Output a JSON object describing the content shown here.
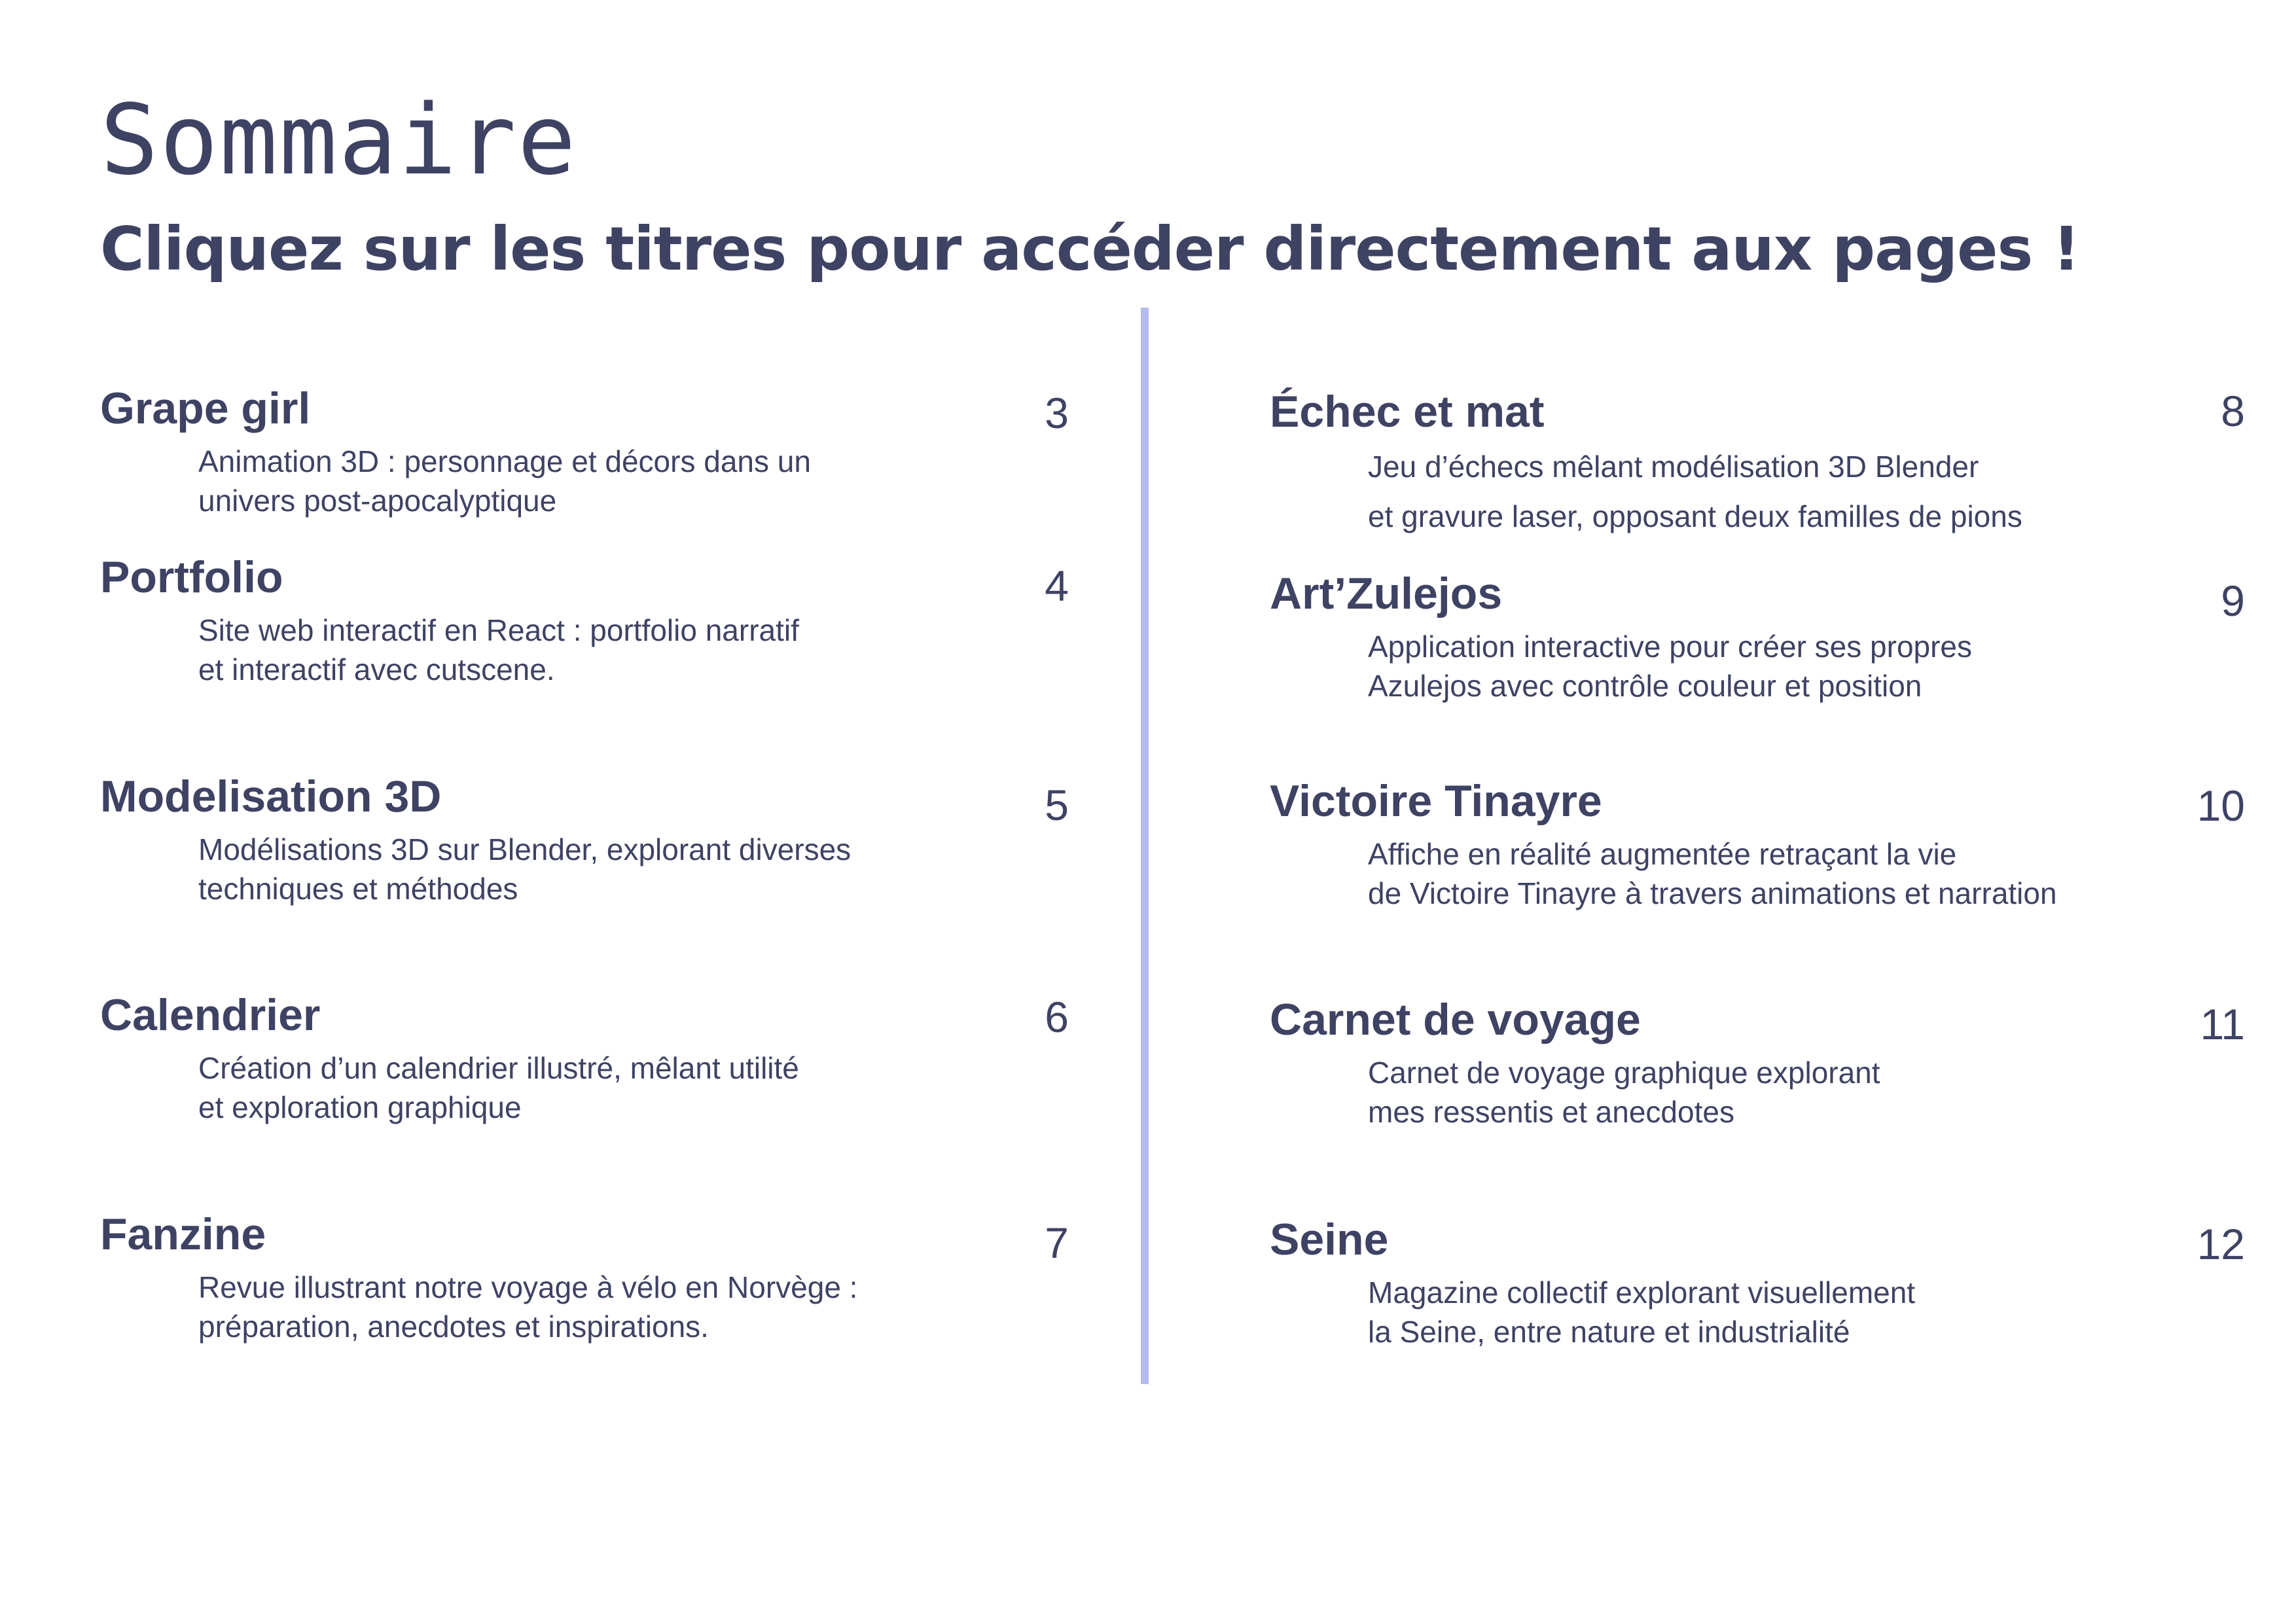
{
  "page": {
    "title": "Sommaire",
    "subtitle": "Cliquez sur les titres pour accéder directement aux pages !"
  },
  "colors": {
    "text": "#3e4263",
    "divider": "#b5baf2",
    "background": "#ffffff"
  },
  "left_entries": [
    {
      "title": "Grape girl",
      "page": "3",
      "desc_line1": "Animation 3D : personnage et décors dans un",
      "desc_line2": "univers post-apocalyptique"
    },
    {
      "title": "Portfolio",
      "page": "4",
      "desc_line1": "Site web interactif en React : portfolio narratif",
      "desc_line2": "et interactif avec cutscene."
    },
    {
      "title": "Modelisation 3D",
      "page": "5",
      "desc_line1": "Modélisations 3D sur Blender, explorant diverses",
      "desc_line2": "techniques et méthodes"
    },
    {
      "title": "Calendrier",
      "page": "6",
      "desc_line1": "Création d’un calendrier illustré, mêlant utilité",
      "desc_line2": "et exploration graphique"
    },
    {
      "title": "Fanzine",
      "page": "7",
      "desc_line1": "Revue illustrant notre voyage à vélo en Norvège :",
      "desc_line2": "préparation, anecdotes et inspirations."
    }
  ],
  "right_entries": [
    {
      "title": "Échec et mat",
      "page": "8",
      "desc_line1": "Jeu d’échecs mêlant modélisation 3D Blender",
      "desc_line2": "et gravure laser, opposant deux familles de pions"
    },
    {
      "title": "Art’Zulejos",
      "page": "9",
      "desc_line1": "Application interactive pour créer ses propres",
      "desc_line2": "Azulejos avec contrôle couleur et position"
    },
    {
      "title": "Victoire Tinayre",
      "page": "10",
      "desc_line1": "Affiche en réalité augmentée retraçant la vie",
      "desc_line2": "de Victoire Tinayre à travers animations et narration"
    },
    {
      "title": "Carnet de voyage",
      "page": "11",
      "desc_line1": "Carnet de voyage graphique explorant",
      "desc_line2": "mes ressentis et anecdotes"
    },
    {
      "title": "Seine",
      "page": "12",
      "desc_line1": "Magazine collectif explorant visuellement",
      "desc_line2": "la Seine, entre nature et industrialité"
    }
  ]
}
